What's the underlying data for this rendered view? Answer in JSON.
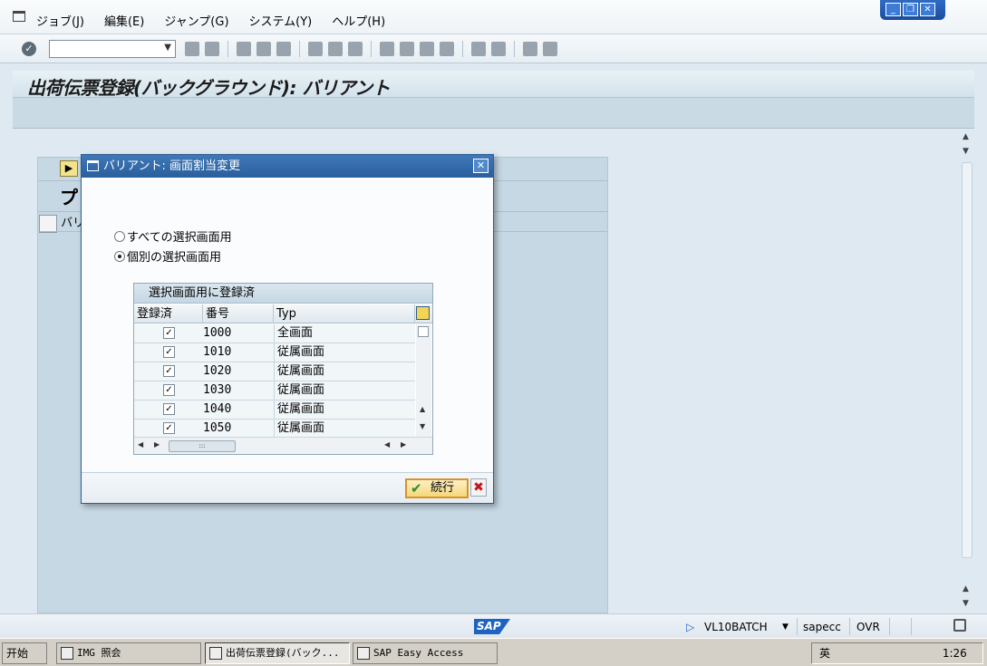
{
  "menu": {
    "items": [
      "ジョブ(J)",
      "編集(E)",
      "ジャンプ(G)",
      "システム(Y)",
      "ヘルプ(H)"
    ]
  },
  "window_controls": [
    "_",
    "❐",
    "✕"
  ],
  "toolbar": {
    "command_field_value": ""
  },
  "screen": {
    "title": "出荷伝票登録(バックグラウンド): バリアント",
    "behind_label_1": "プ",
    "behind_label_2": "バリ"
  },
  "dialog": {
    "title": "バリアント: 画面割当変更",
    "close_glyph": "✕",
    "radio_all": "すべての選択画面用",
    "radio_individual": "個別の選択画面用",
    "selected_option": "individual",
    "table": {
      "caption": "選択画面用に登録済",
      "columns": [
        "登録済",
        "番号",
        "Typ"
      ],
      "rows": [
        {
          "registered": true,
          "number": "1000",
          "type": "全画面"
        },
        {
          "registered": true,
          "number": "1010",
          "type": "従属画面"
        },
        {
          "registered": true,
          "number": "1020",
          "type": "従属画面"
        },
        {
          "registered": true,
          "number": "1030",
          "type": "従属画面"
        },
        {
          "registered": true,
          "number": "1040",
          "type": "従属画面"
        },
        {
          "registered": true,
          "number": "1050",
          "type": "従属画面"
        }
      ]
    },
    "continue_label": "続行",
    "cancel_glyph": "✖"
  },
  "statusbar": {
    "sap_logo": "SAP",
    "transaction": "VL10BATCH",
    "server": "sapecc",
    "mode": "OVR"
  },
  "taskbar": {
    "start_label": "开始",
    "tasks": [
      {
        "label": "IMG 照会"
      },
      {
        "label": "出荷伝票登録(バック..."
      },
      {
        "label": "SAP Easy Access"
      }
    ],
    "tray_text": "英",
    "time": "1:26"
  },
  "colors": {
    "dialog_title_bg": "#2a5e9c",
    "sap_blue": "#1f63c0",
    "confirm_border": "#d8922b",
    "cancel_red": "#c4161c"
  }
}
